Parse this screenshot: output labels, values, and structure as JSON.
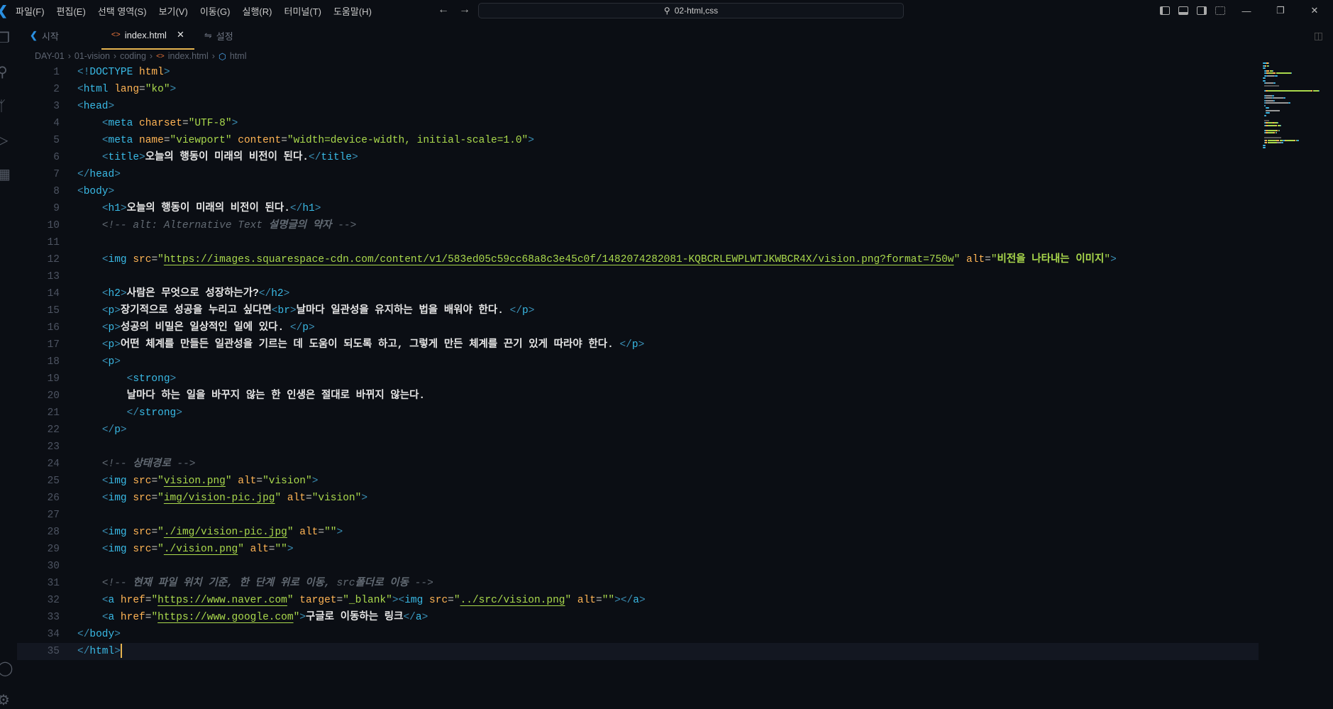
{
  "titlebar": {
    "menus": [
      "파일(F)",
      "편집(E)",
      "선택 영역(S)",
      "보기(V)",
      "이동(G)",
      "실행(R)",
      "터미널(T)",
      "도움말(H)"
    ],
    "search": "02-html,css"
  },
  "tabs": [
    {
      "label": "시작"
    },
    {
      "label": "index.html",
      "active": true
    },
    {
      "label": "설정"
    }
  ],
  "breadcrumb": [
    "DAY-01",
    "01-vision",
    "coding",
    "index.html",
    "html"
  ],
  "colors": {
    "background": "#0b0e14",
    "tag": "#39bae6",
    "attribute": "#ffb454",
    "string": "#aad94c",
    "comment": "#626a73",
    "cursor": "#e6b450"
  },
  "editor": {
    "current_line": 35,
    "lines": [
      [
        [
          "p",
          "<!"
        ],
        [
          "t",
          "DOCTYPE"
        ],
        [
          "a",
          " html"
        ],
        [
          "p",
          ">"
        ]
      ],
      [
        [
          "p",
          "<"
        ],
        [
          "t",
          "html"
        ],
        [
          "a",
          " lang"
        ],
        [
          "o",
          "="
        ],
        [
          "s",
          "\"ko\""
        ],
        [
          "p",
          ">"
        ]
      ],
      [
        [
          "p",
          "<"
        ],
        [
          "t",
          "head"
        ],
        [
          "p",
          ">"
        ]
      ],
      [
        [
          "o",
          "    "
        ],
        [
          "p",
          "<"
        ],
        [
          "t",
          "meta"
        ],
        [
          "a",
          " charset"
        ],
        [
          "o",
          "="
        ],
        [
          "s",
          "\"UTF-8\""
        ],
        [
          "p",
          ">"
        ]
      ],
      [
        [
          "o",
          "    "
        ],
        [
          "p",
          "<"
        ],
        [
          "t",
          "meta"
        ],
        [
          "a",
          " name"
        ],
        [
          "o",
          "="
        ],
        [
          "s",
          "\"viewport\""
        ],
        [
          "a",
          " content"
        ],
        [
          "o",
          "="
        ],
        [
          "s",
          "\"width=device-width, initial-scale=1.0\""
        ],
        [
          "p",
          ">"
        ]
      ],
      [
        [
          "o",
          "    "
        ],
        [
          "p",
          "<"
        ],
        [
          "t",
          "title"
        ],
        [
          "p",
          ">"
        ],
        [
          "x",
          "오늘의 행동이 미래의 비전이 된다."
        ],
        [
          "p",
          "</"
        ],
        [
          "t",
          "title"
        ],
        [
          "p",
          ">"
        ]
      ],
      [
        [
          "p",
          "</"
        ],
        [
          "t",
          "head"
        ],
        [
          "p",
          ">"
        ]
      ],
      [
        [
          "p",
          "<"
        ],
        [
          "t",
          "body"
        ],
        [
          "p",
          ">"
        ]
      ],
      [
        [
          "o",
          "    "
        ],
        [
          "p",
          "<"
        ],
        [
          "t",
          "h1"
        ],
        [
          "p",
          ">"
        ],
        [
          "x",
          "오늘의 행동이 미래의 비전이 된다."
        ],
        [
          "p",
          "</"
        ],
        [
          "t",
          "h1"
        ],
        [
          "p",
          ">"
        ]
      ],
      [
        [
          "o",
          "    "
        ],
        [
          "c",
          "<!-- alt: Alternative Text "
        ],
        [
          "ck",
          "설명글의 약자"
        ],
        [
          "c",
          " -->"
        ]
      ],
      [],
      [
        [
          "o",
          "    "
        ],
        [
          "p",
          "<"
        ],
        [
          "t",
          "img"
        ],
        [
          "a",
          " src"
        ],
        [
          "o",
          "="
        ],
        [
          "s",
          "\""
        ],
        [
          "u",
          "https://images.squarespace-cdn.com/content/v1/583ed05c59cc68a8c3e45c0f/1482074282081-KQBCRLEWPLWTJKWBCR4X/vision.png?format=750w"
        ],
        [
          "s",
          "\""
        ],
        [
          "a",
          " alt"
        ],
        [
          "o",
          "="
        ],
        [
          "s",
          "\""
        ],
        [
          "sk",
          "비전을 나타내는 이미지"
        ],
        [
          "s",
          "\""
        ],
        [
          "p",
          ">"
        ]
      ],
      [],
      [
        [
          "o",
          "    "
        ],
        [
          "p",
          "<"
        ],
        [
          "t",
          "h2"
        ],
        [
          "p",
          ">"
        ],
        [
          "x",
          "사람은 무엇으로 성장하는가?"
        ],
        [
          "p",
          "</"
        ],
        [
          "t",
          "h2"
        ],
        [
          "p",
          ">"
        ]
      ],
      [
        [
          "o",
          "    "
        ],
        [
          "p",
          "<"
        ],
        [
          "t",
          "p"
        ],
        [
          "p",
          ">"
        ],
        [
          "x",
          "장기적으로 성공을 누리고 싶다면"
        ],
        [
          "p",
          "<"
        ],
        [
          "t",
          "br"
        ],
        [
          "p",
          ">"
        ],
        [
          "x",
          "날마다 일관성을 유지하는 법을 배워야 한다. "
        ],
        [
          "p",
          "</"
        ],
        [
          "t",
          "p"
        ],
        [
          "p",
          ">"
        ]
      ],
      [
        [
          "o",
          "    "
        ],
        [
          "p",
          "<"
        ],
        [
          "t",
          "p"
        ],
        [
          "p",
          ">"
        ],
        [
          "x",
          "성공의 비밀은 일상적인 일에 있다. "
        ],
        [
          "p",
          "</"
        ],
        [
          "t",
          "p"
        ],
        [
          "p",
          ">"
        ]
      ],
      [
        [
          "o",
          "    "
        ],
        [
          "p",
          "<"
        ],
        [
          "t",
          "p"
        ],
        [
          "p",
          ">"
        ],
        [
          "x",
          "어떤 체계를 만들든 일관성을 기르는 데 도움이 되도록 하고, 그렇게 만든 체계를 끈기 있게 따라야 한다. "
        ],
        [
          "p",
          "</"
        ],
        [
          "t",
          "p"
        ],
        [
          "p",
          ">"
        ]
      ],
      [
        [
          "o",
          "    "
        ],
        [
          "p",
          "<"
        ],
        [
          "t",
          "p"
        ],
        [
          "p",
          ">"
        ]
      ],
      [
        [
          "o",
          "        "
        ],
        [
          "p",
          "<"
        ],
        [
          "t",
          "strong"
        ],
        [
          "p",
          ">"
        ]
      ],
      [
        [
          "o",
          "        "
        ],
        [
          "x",
          "날마다 하는 일을 바꾸지 않는 한 인생은 절대로 바뀌지 않는다."
        ]
      ],
      [
        [
          "o",
          "        "
        ],
        [
          "p",
          "</"
        ],
        [
          "t",
          "strong"
        ],
        [
          "p",
          ">"
        ]
      ],
      [
        [
          "o",
          "    "
        ],
        [
          "p",
          "</"
        ],
        [
          "t",
          "p"
        ],
        [
          "p",
          ">"
        ]
      ],
      [],
      [
        [
          "o",
          "    "
        ],
        [
          "c",
          "<!-- "
        ],
        [
          "ck",
          "상태경로"
        ],
        [
          "c",
          " -->"
        ]
      ],
      [
        [
          "o",
          "    "
        ],
        [
          "p",
          "<"
        ],
        [
          "t",
          "img"
        ],
        [
          "a",
          " src"
        ],
        [
          "o",
          "="
        ],
        [
          "s",
          "\""
        ],
        [
          "u",
          "vision.png"
        ],
        [
          "s",
          "\""
        ],
        [
          "a",
          " alt"
        ],
        [
          "o",
          "="
        ],
        [
          "s",
          "\"vision\""
        ],
        [
          "p",
          ">"
        ]
      ],
      [
        [
          "o",
          "    "
        ],
        [
          "p",
          "<"
        ],
        [
          "t",
          "img"
        ],
        [
          "a",
          " src"
        ],
        [
          "o",
          "="
        ],
        [
          "s",
          "\""
        ],
        [
          "u",
          "img/vision-pic.jpg"
        ],
        [
          "s",
          "\""
        ],
        [
          "a",
          " alt"
        ],
        [
          "o",
          "="
        ],
        [
          "s",
          "\"vision\""
        ],
        [
          "p",
          ">"
        ]
      ],
      [],
      [
        [
          "o",
          "    "
        ],
        [
          "p",
          "<"
        ],
        [
          "t",
          "img"
        ],
        [
          "a",
          " src"
        ],
        [
          "o",
          "="
        ],
        [
          "s",
          "\""
        ],
        [
          "u",
          "./img/vision-pic.jpg"
        ],
        [
          "s",
          "\""
        ],
        [
          "a",
          " alt"
        ],
        [
          "o",
          "="
        ],
        [
          "s",
          "\"\""
        ],
        [
          "p",
          ">"
        ]
      ],
      [
        [
          "o",
          "    "
        ],
        [
          "p",
          "<"
        ],
        [
          "t",
          "img"
        ],
        [
          "a",
          " src"
        ],
        [
          "o",
          "="
        ],
        [
          "s",
          "\""
        ],
        [
          "u",
          "./vision.png"
        ],
        [
          "s",
          "\""
        ],
        [
          "a",
          " alt"
        ],
        [
          "o",
          "="
        ],
        [
          "s",
          "\"\""
        ],
        [
          "p",
          ">"
        ]
      ],
      [],
      [
        [
          "o",
          "    "
        ],
        [
          "c",
          "<!-- "
        ],
        [
          "ck",
          "현재 파일 위치 기준, 한 단계 위로 이동,"
        ],
        [
          "c",
          " src"
        ],
        [
          "ck",
          "폴더로 이동"
        ],
        [
          "c",
          " -->"
        ]
      ],
      [
        [
          "o",
          "    "
        ],
        [
          "p",
          "<"
        ],
        [
          "t",
          "a"
        ],
        [
          "a",
          " href"
        ],
        [
          "o",
          "="
        ],
        [
          "s",
          "\""
        ],
        [
          "u",
          "https://www.naver.com"
        ],
        [
          "s",
          "\""
        ],
        [
          "a",
          " target"
        ],
        [
          "o",
          "="
        ],
        [
          "s",
          "\"_blank\""
        ],
        [
          "p",
          "><"
        ],
        [
          "t",
          "img"
        ],
        [
          "a",
          " src"
        ],
        [
          "o",
          "="
        ],
        [
          "s",
          "\""
        ],
        [
          "u",
          "../src/vision.png"
        ],
        [
          "s",
          "\""
        ],
        [
          "a",
          " alt"
        ],
        [
          "o",
          "="
        ],
        [
          "s",
          "\"\""
        ],
        [
          "p",
          "></"
        ],
        [
          "t",
          "a"
        ],
        [
          "p",
          ">"
        ]
      ],
      [
        [
          "o",
          "    "
        ],
        [
          "p",
          "<"
        ],
        [
          "t",
          "a"
        ],
        [
          "a",
          " href"
        ],
        [
          "o",
          "="
        ],
        [
          "s",
          "\""
        ],
        [
          "u",
          "https://www.google.com"
        ],
        [
          "s",
          "\""
        ],
        [
          "p",
          ">"
        ],
        [
          "x",
          "구글로 이동하는 링크"
        ],
        [
          "p",
          "</"
        ],
        [
          "t",
          "a"
        ],
        [
          "p",
          ">"
        ]
      ],
      [
        [
          "p",
          "</"
        ],
        [
          "t",
          "body"
        ],
        [
          "p",
          ">"
        ]
      ],
      [
        [
          "p",
          "</"
        ],
        [
          "t",
          "html"
        ],
        [
          "p",
          ">"
        ]
      ]
    ]
  }
}
